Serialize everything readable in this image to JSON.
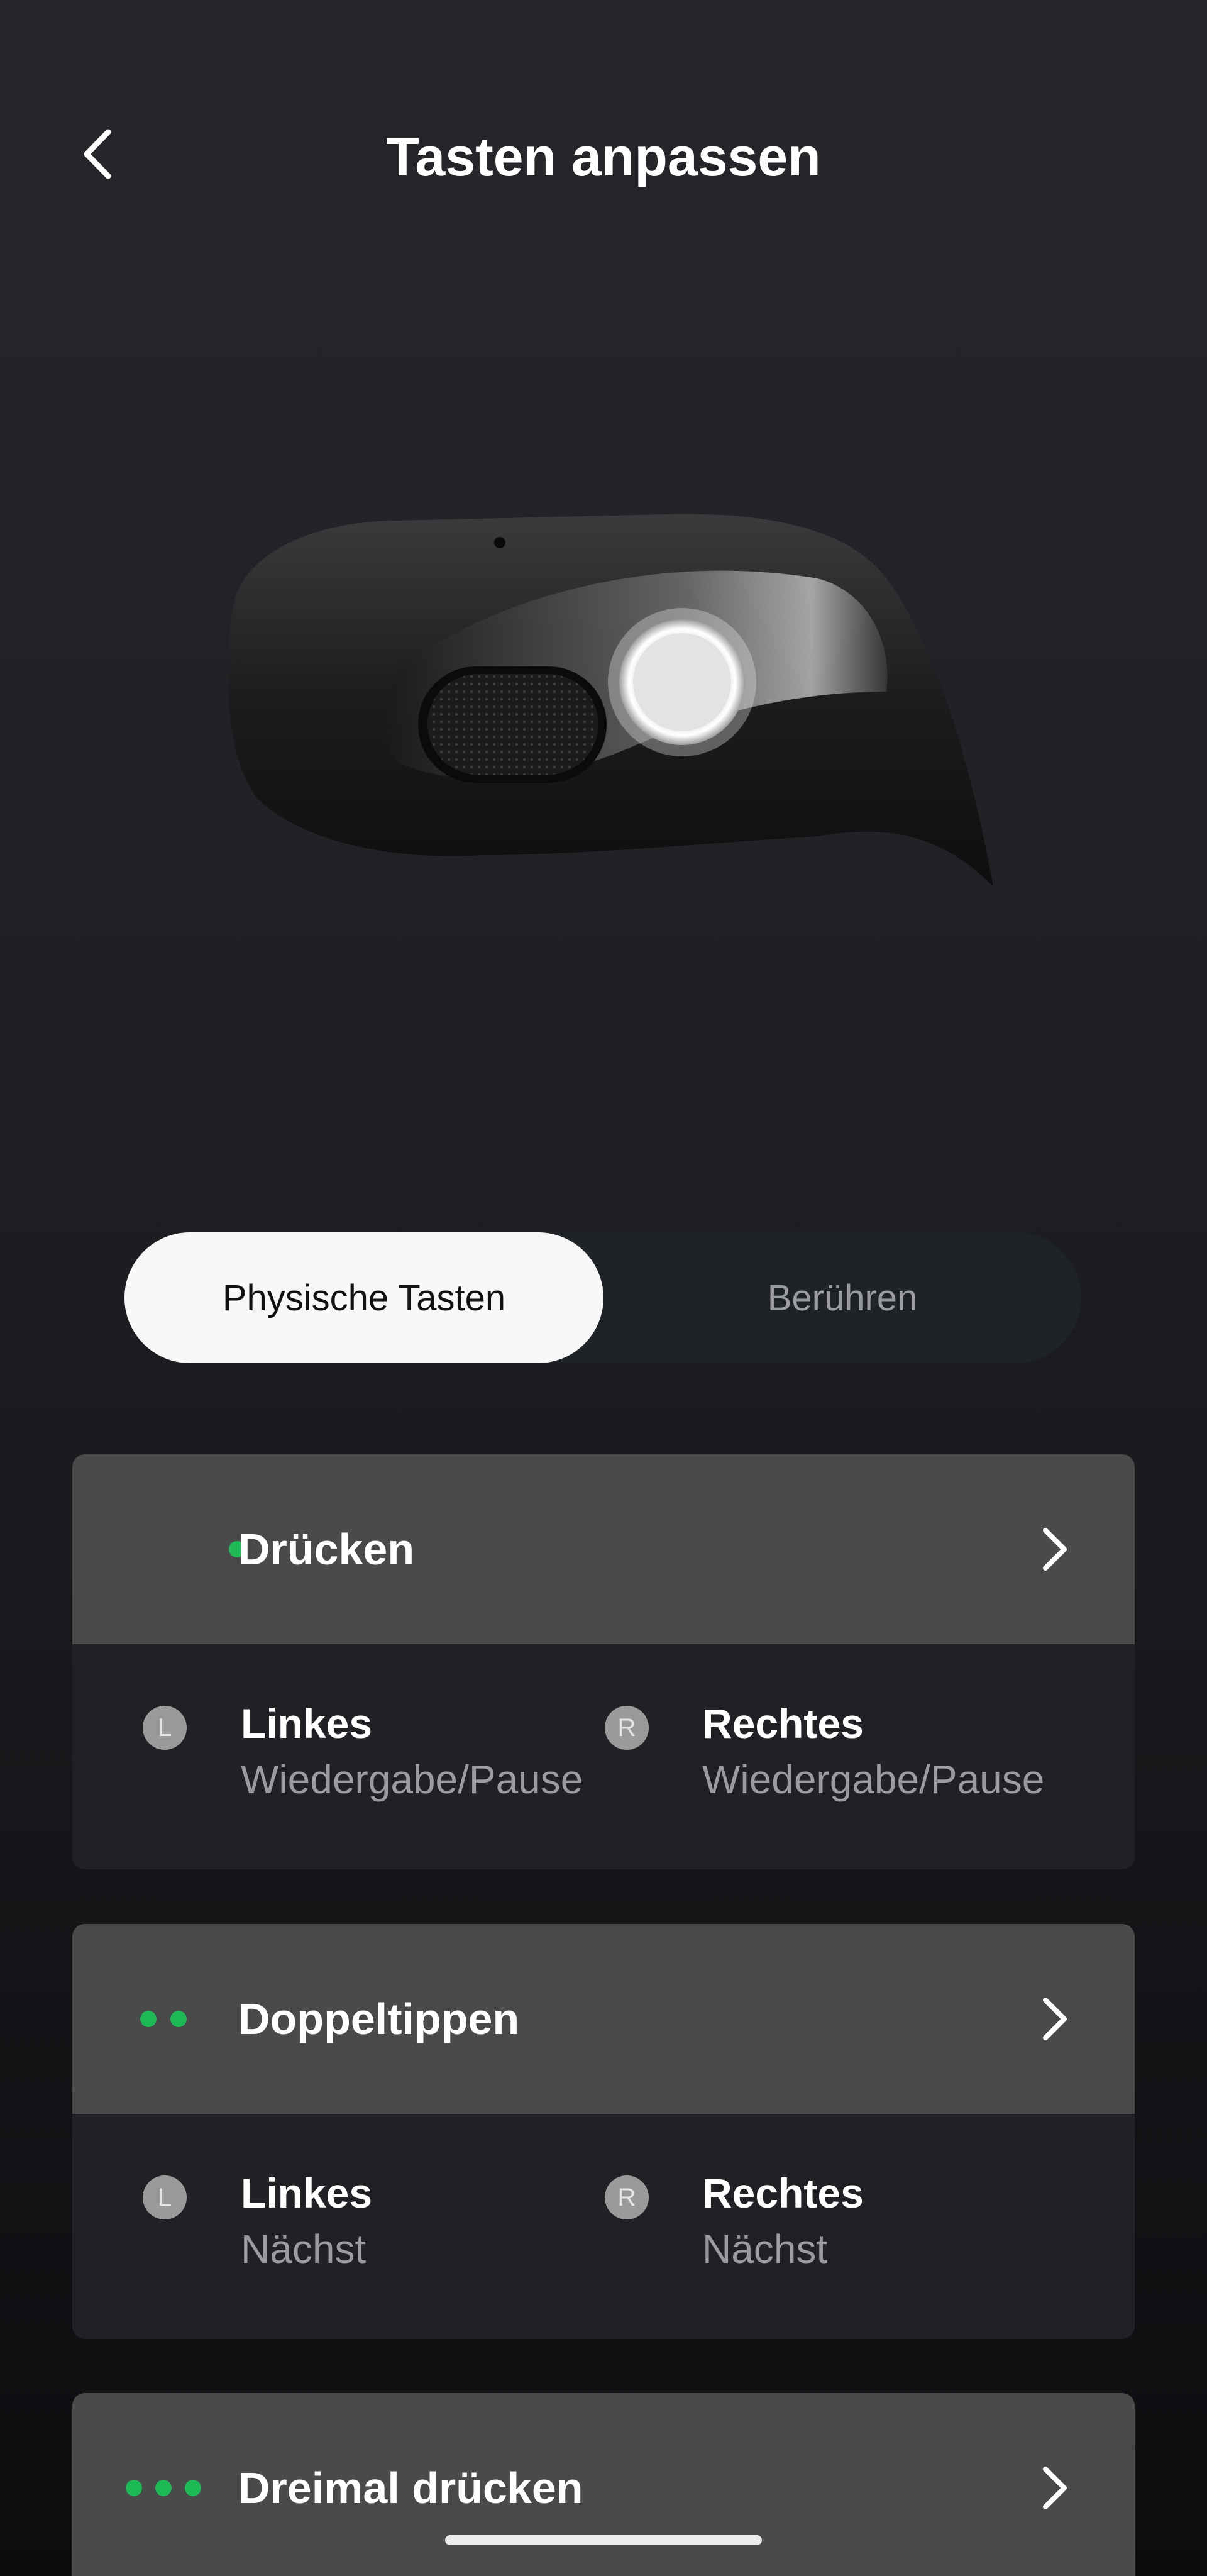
{
  "header": {
    "title": "Tasten anpassen"
  },
  "tabs": [
    {
      "label": "Physische Tasten",
      "active": true
    },
    {
      "label": "Berühren",
      "active": false
    }
  ],
  "gestures": [
    {
      "title": "Drücken",
      "dots": 1,
      "left": {
        "badge": "L",
        "name": "Linkes",
        "value": "Wiedergabe/Pause"
      },
      "right": {
        "badge": "R",
        "name": "Rechtes",
        "value": "Wiedergabe/Pause"
      }
    },
    {
      "title": "Doppeltippen",
      "dots": 2,
      "left": {
        "badge": "L",
        "name": "Linkes",
        "value": "Nächst"
      },
      "right": {
        "badge": "R",
        "name": "Rechtes",
        "value": "Nächst"
      }
    },
    {
      "title": "Dreimal drücken",
      "dots": 3
    }
  ],
  "colors": {
    "accent": "#1db954",
    "card_header": "#4a4a4a",
    "card_body": "#1f2125"
  }
}
